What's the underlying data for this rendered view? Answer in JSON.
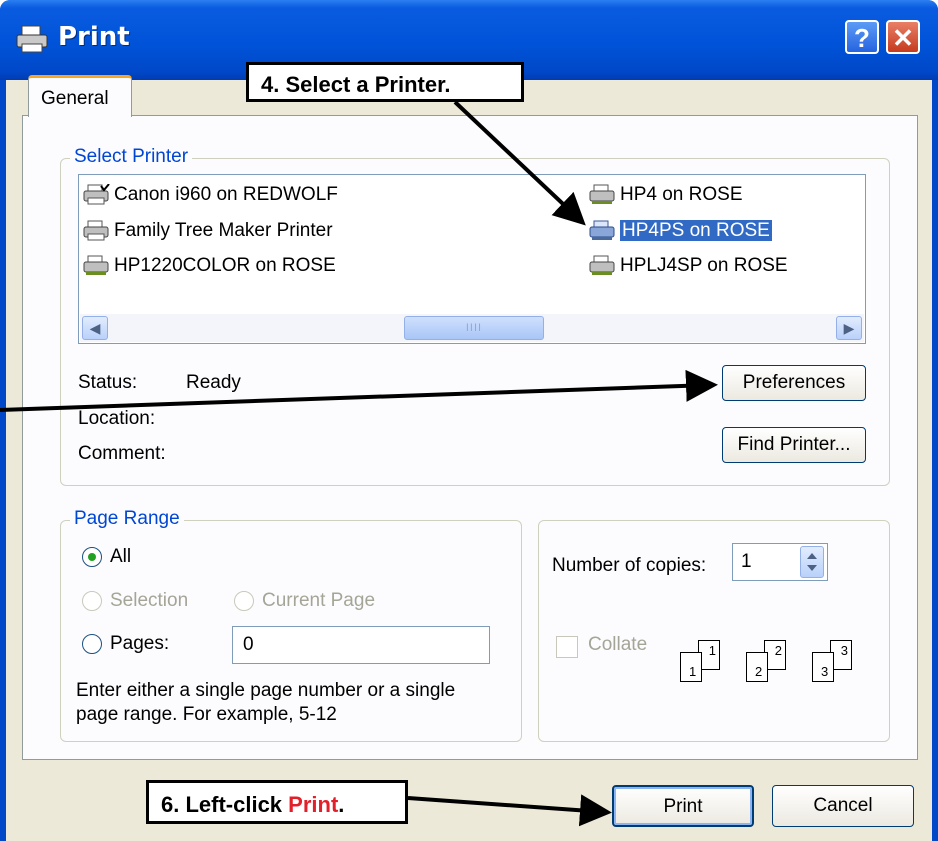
{
  "window": {
    "title": "Print",
    "help_label": "?",
    "close_label": "✕",
    "icon": "printer-icon"
  },
  "tabs": [
    {
      "label": "General",
      "active": true
    }
  ],
  "select_printer": {
    "group_label": "Select Printer",
    "printers": [
      {
        "label": "Canon i960 on REDWOLF",
        "icon": "printer-default-icon",
        "selected": false
      },
      {
        "label": "Family Tree Maker Printer",
        "icon": "printer-icon",
        "selected": false
      },
      {
        "label": "HP1220COLOR on ROSE",
        "icon": "network-printer-icon",
        "selected": false
      },
      {
        "label": "HP4 on ROSE",
        "icon": "network-printer-icon",
        "selected": false
      },
      {
        "label": "HP4PS on ROSE",
        "icon": "network-printer-icon",
        "selected": true
      },
      {
        "label": "HPLJ4SP on ROSE",
        "icon": "network-printer-icon",
        "selected": false
      }
    ],
    "scroll_left": "◀",
    "scroll_right": "▶",
    "scroll_grip": "IIII",
    "status_label": "Status:",
    "status_value": "Ready",
    "location_label": "Location:",
    "location_value": "",
    "comment_label": "Comment:",
    "comment_value": "",
    "preferences_button": "Preferences",
    "find_printer_button": "Find Printer..."
  },
  "page_range": {
    "group_label": "Page Range",
    "all_label": "All",
    "selection_label": "Selection",
    "current_page_label": "Current Page",
    "pages_label": "Pages:",
    "pages_value": "0",
    "hint_line1": "Enter either a single page number or a single",
    "hint_line2": "page range.  For example, 5-12",
    "selected_option": "All"
  },
  "copies": {
    "label": "Number of copies:",
    "value": "1",
    "collate_label": "Collate",
    "collate_checked": false,
    "collate_pages": [
      "1",
      "1",
      "2",
      "2",
      "3",
      "3"
    ]
  },
  "buttons": {
    "print": "Print",
    "cancel": "Cancel"
  },
  "callouts": {
    "step4": "4.   Select a Printer.",
    "step6_prefix": "6.   Left-click ",
    "step6_emphasis": "Print",
    "step6_suffix": "."
  },
  "colors": {
    "titlebar": "#0053d8",
    "dialog": "#ece9d8",
    "selection": "#316ac5",
    "group_label": "#0046d5",
    "callout_emphasis": "#e3202a"
  }
}
